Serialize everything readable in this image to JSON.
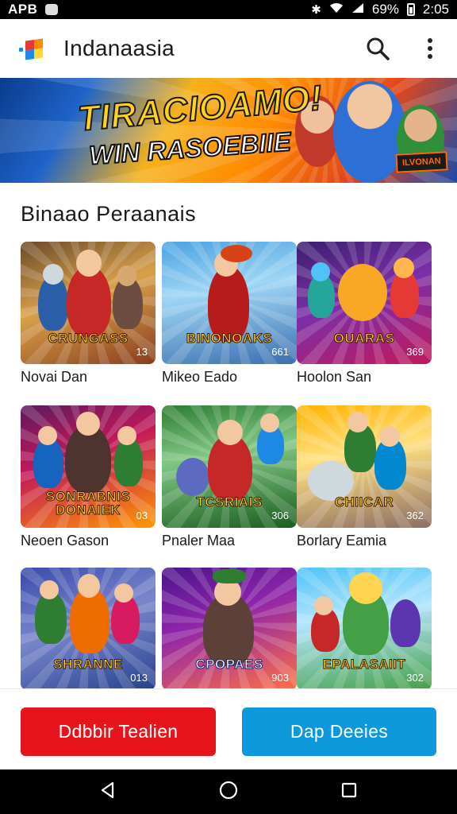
{
  "status_bar": {
    "carrier": "APB",
    "battery_percent": "69%",
    "time": "2:05"
  },
  "app_bar": {
    "title": "Indanaasia"
  },
  "banner": {
    "headline": "TIRACIOAMO!",
    "subline": "WIN RASOEBIIE",
    "badge": "ILVONAN"
  },
  "section": {
    "title": "Binaao Peraanais"
  },
  "games": [
    {
      "label": "Novai Dan",
      "thumb_title": "CRUNGASS",
      "count": "13"
    },
    {
      "label": "Mikeo Eado",
      "thumb_title": "BINONOAKS",
      "count": "661"
    },
    {
      "label": "Hoolon San",
      "thumb_title": "OUARAS",
      "count": "369"
    },
    {
      "label": "Neoen Gason",
      "thumb_title": "SONRABNIS DONAIEK",
      "count": "03"
    },
    {
      "label": "Pnaler Maa",
      "thumb_title": "TCSRIAIS",
      "count": "306"
    },
    {
      "label": "Borlary Eamia",
      "thumb_title": "CHIICAR",
      "count": "362"
    },
    {
      "label": "",
      "thumb_title": "SHRANNE",
      "count": "013"
    },
    {
      "label": "",
      "thumb_title": "CPOPAES",
      "count": "903"
    },
    {
      "label": "",
      "thumb_title": "EPALASAIIT",
      "count": "302"
    }
  ],
  "buttons": {
    "primary": "Ddbbir Tealien",
    "secondary": "Dap Deeies"
  },
  "colors": {
    "primary_button": "#e8141b",
    "secondary_button": "#0e98dc"
  }
}
